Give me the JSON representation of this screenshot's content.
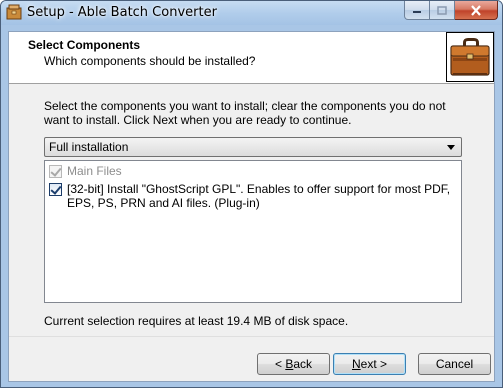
{
  "window": {
    "title": "Setup - Able Batch Converter",
    "icons": {
      "app": "installer-box-icon",
      "minimize": "minimize-icon",
      "maximize": "maximize-icon",
      "close": "close-icon"
    }
  },
  "header": {
    "title": "Select Components",
    "subtitle": "Which components should be installed?",
    "image_icon": "briefcase-icon"
  },
  "body": {
    "instructions": "Select the components you want to install; clear the components you do not want to install. Click Next when you are ready to continue.",
    "install_type": {
      "selected": "Full installation"
    },
    "components": [
      {
        "label": "Main Files",
        "checked": true,
        "enabled": false
      },
      {
        "label": "[32-bit] Install \"GhostScript GPL\". Enables to offer support for most PDF, EPS, PS, PRN and AI files. (Plug-in)",
        "checked": true,
        "enabled": true
      }
    ],
    "space_required": "Current selection requires at least 19.4 MB of disk space."
  },
  "buttons": {
    "back_prefix": "< ",
    "back_accel": "B",
    "back_rest": "ack",
    "next_accel": "N",
    "next_rest": "ext >",
    "cancel": "Cancel"
  }
}
